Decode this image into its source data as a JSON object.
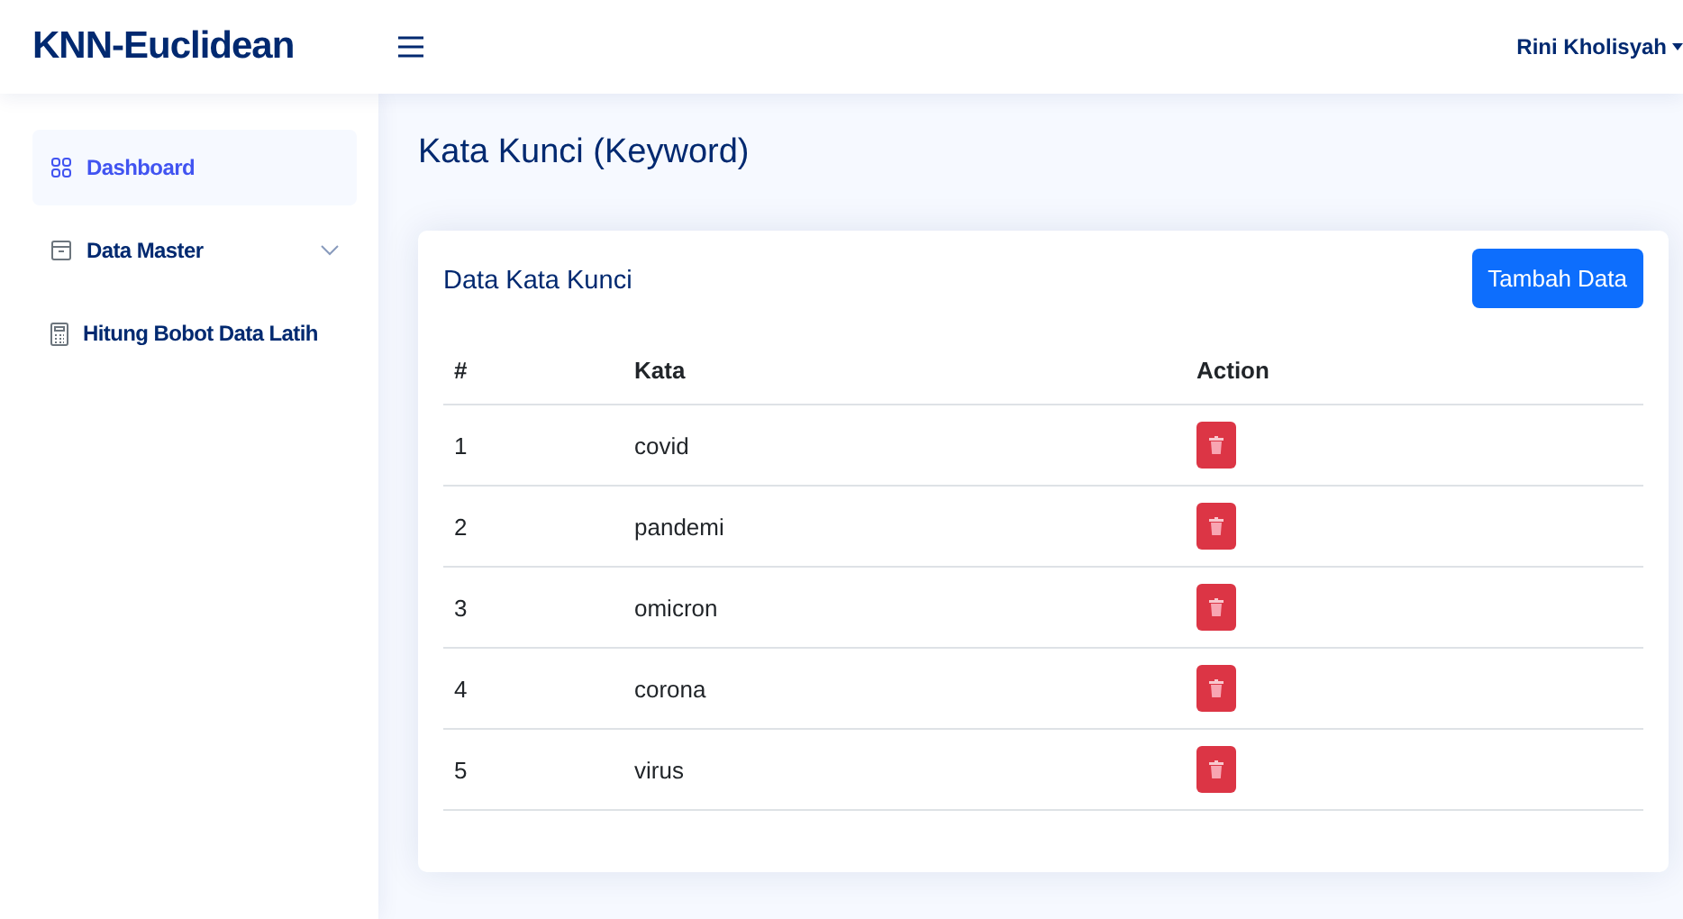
{
  "brand": "KNN-Euclidean",
  "user": {
    "name": "Rini Kholisyah"
  },
  "sidebar": {
    "items": [
      {
        "kind": "grid",
        "label": "Dashboard",
        "selected": true
      },
      {
        "kind": "folder",
        "label": "Data Master",
        "selected": false
      },
      {
        "kind": "calculator",
        "label": "Hitung Bobot Data Latih",
        "selected": false
      }
    ]
  },
  "page_title": "Kata Kunci (Keyword)",
  "card": {
    "title": "Data Kata Kunci",
    "button": "Tambah Data",
    "columns": [
      "#",
      "Kata",
      "Action"
    ],
    "rows": [
      {
        "no": "1",
        "kata": "covid"
      },
      {
        "no": "2",
        "kata": "pandemi"
      },
      {
        "no": "3",
        "kata": "omicron"
      },
      {
        "no": "4",
        "kata": "corona"
      },
      {
        "no": "5",
        "kata": "virus"
      }
    ]
  }
}
